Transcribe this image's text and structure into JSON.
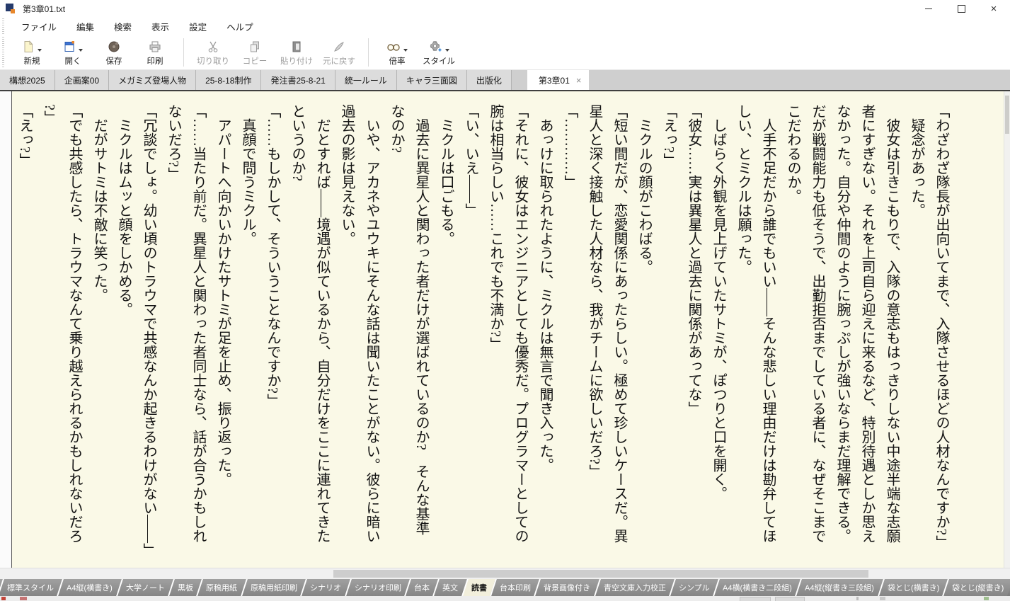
{
  "window": {
    "title": "第3章01.txt",
    "close_glyph": "×"
  },
  "menu": {
    "items": [
      "ファイル",
      "編集",
      "検索",
      "表示",
      "設定",
      "ヘルプ"
    ]
  },
  "toolbar": {
    "groups": [
      {
        "buttons": [
          {
            "label": "新規",
            "icon": "new-document-icon",
            "dropdown": true,
            "enabled": true
          },
          {
            "label": "開く",
            "icon": "open-file-icon",
            "dropdown": true,
            "enabled": true
          },
          {
            "label": "保存",
            "icon": "save-icon",
            "dropdown": false,
            "enabled": true
          },
          {
            "label": "印刷",
            "icon": "print-icon",
            "dropdown": false,
            "enabled": true
          }
        ]
      },
      {
        "buttons": [
          {
            "label": "切り取り",
            "icon": "cut-icon",
            "dropdown": false,
            "enabled": false
          },
          {
            "label": "コピー",
            "icon": "copy-icon",
            "dropdown": false,
            "enabled": false
          },
          {
            "label": "貼り付け",
            "icon": "paste-icon",
            "dropdown": false,
            "enabled": false
          },
          {
            "label": "元に戻す",
            "icon": "undo-icon",
            "dropdown": false,
            "enabled": false
          }
        ]
      },
      {
        "buttons": [
          {
            "label": "倍率",
            "icon": "magnify-icon",
            "dropdown": true,
            "enabled": true
          },
          {
            "label": "スタイル",
            "icon": "style-gear-icon",
            "dropdown": true,
            "enabled": true
          }
        ]
      }
    ]
  },
  "document_tabs": {
    "close_glyph": "×",
    "tabs": [
      {
        "label": "構想2025",
        "active": false
      },
      {
        "label": "企画案00",
        "active": false
      },
      {
        "label": "メガミズ登場人物",
        "active": false
      },
      {
        "label": "25-8-18制作",
        "active": false
      },
      {
        "label": "発注書25-8-21",
        "active": false
      },
      {
        "label": "統一ルール",
        "active": false
      },
      {
        "label": "キャラ三面図",
        "active": false
      },
      {
        "label": "出版化",
        "active": false
      },
      {
        "label": "第3章01",
        "active": true
      }
    ]
  },
  "editor": {
    "vertical_lines": [
      "「わざわざ隊長が出向いてまで、入隊させるほどの人材なんですか?」",
      "　疑念があった。",
      "　彼女は引きこもりで、入隊の意志もはっきりしない中途半端な志願",
      "者にすぎない。それを上司自ら迎えに来るなど、特別待遇としか思え",
      "なかった。自分や仲間のように腕っぷしが強いならまだ理解できる。",
      "だが戦闘能力も低そうで、出勤拒否までしている者に、なぜそこまで",
      "こだわるのか。",
      "　人手不足だから誰でもいい――そんな悲しい理由だけは勘弁してほ",
      "しい、とミクルは願った。",
      "　しばらく外観を見上げていたサトミが、ぽつりと口を開く。",
      "「彼女……実は異星人と過去に関係があってな」",
      "「えっ?」",
      "　ミクルの顔がこわばる。",
      "「短い間だが、恋愛関係にあったらしい。極めて珍しいケースだ。異",
      "星人と深く接触した人材なら、我がチームに欲しいだろ?」",
      "「…………」",
      "　あっけに取られたように、ミクルは無言で聞き入った。",
      "「それに、彼女はエンジニアとしても優秀だ。プログラマーとしての",
      "腕は相当らしい……これでも不満か?」",
      "「い、いえ――」",
      "　ミクルは口ごもる。",
      "　過去に異星人と関わった者だけが選ばれているのか?　そんな基準",
      "なのか?",
      "　いや、アカネやユウキにそんな話は聞いたことがない。彼らに暗い",
      "過去の影は見えない。",
      "　だとすれば――境遇が似ているから、自分だけをここに連れてきた",
      "というのか?",
      "「……もしかして、そういうことなんですか?」",
      "　真顔で問うミクル。",
      "　アパートへ向かいかけたサトミが足を止め、振り返った。",
      "「……当たり前だ。異星人と関わった者同士なら、話が合うかもしれ",
      "ないだろ?」",
      "「冗談でしょ。幼い頃のトラウマで共感なんか起きるわけがない――」",
      "　ミクルはムッと顔をしかめる。",
      "　だがサトミは不敵に笑った。",
      "「でも共感したら、トラウマなんて乗り越えられるかもしれないだろ",
      "?」",
      "「えっ?」"
    ]
  },
  "style_tabs": {
    "tabs": [
      {
        "label": "標準スタイル",
        "active": false
      },
      {
        "label": "A4縦(横書き)",
        "active": false
      },
      {
        "label": "大学ノート",
        "active": false
      },
      {
        "label": "黒板",
        "active": false
      },
      {
        "label": "原稿用紙",
        "active": false
      },
      {
        "label": "原稿用紙印刷",
        "active": false
      },
      {
        "label": "シナリオ",
        "active": false
      },
      {
        "label": "シナリオ印刷",
        "active": false
      },
      {
        "label": "台本",
        "active": false
      },
      {
        "label": "英文",
        "active": false
      },
      {
        "label": "読書",
        "active": true
      },
      {
        "label": "台本印刷",
        "active": false
      },
      {
        "label": "背景画像付き",
        "active": false
      },
      {
        "label": "青空文庫入力校正",
        "active": false
      },
      {
        "label": "シンプル",
        "active": false
      },
      {
        "label": "A4横(横書き二段組)",
        "active": false
      },
      {
        "label": "A4縦(縦書き三段組)",
        "active": false
      },
      {
        "label": "袋とじ(横書き)",
        "active": false
      },
      {
        "label": "袋とじ(縦書き)",
        "active": false
      }
    ]
  },
  "colors": {
    "canvas_background": "#faf9e7",
    "active_style_tab_background": "#f2efdc",
    "style_bar_gray": "#8f8f8f",
    "app_icon_navy": "#253a6b",
    "app_icon_orange": "#e8872b"
  }
}
